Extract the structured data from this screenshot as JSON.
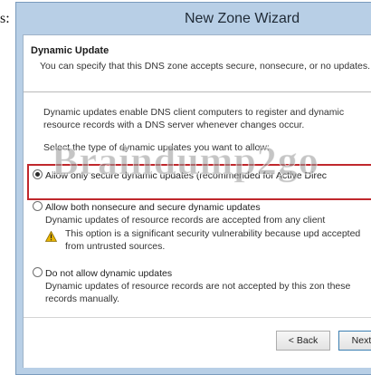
{
  "edge_text": "s:",
  "window": {
    "title": "New Zone Wizard"
  },
  "header": {
    "title": "Dynamic Update",
    "description": "You can specify that this DNS zone accepts secure, nonsecure, or no updates."
  },
  "body": {
    "intro": "Dynamic updates enable DNS client computers to register and dynamic resource records with a DNS server whenever changes occur.",
    "intro_line1": "Dynamic updates enable DNS client computers to register and dynamic",
    "intro_line2": "resource records with a DNS server whenever changes occur.",
    "prompt": "Select the type of dynamic updates you want to allow:"
  },
  "options": [
    {
      "label": "Allow only secure dynamic updates (recommended for Active Direc",
      "description": "",
      "selected": true
    },
    {
      "label": "Allow both nonsecure and secure dynamic updates",
      "description": "Dynamic updates of resource records are accepted from any client",
      "warning": "This option is a significant security vulnerability because upd accepted from untrusted sources.",
      "selected": false
    },
    {
      "label": "Do not allow dynamic updates",
      "description": "Dynamic updates of resource records are not accepted by this zon these records manually.",
      "selected": false
    }
  ],
  "watermark": "Braindump2go",
  "buttons": {
    "back": "< Back",
    "next": "Next >"
  },
  "colors": {
    "selection_border": "#c0282d",
    "title_bar": "#b8cfe6",
    "warning_icon": "#e8b400"
  },
  "icons": {
    "warning": "warning-triangle-icon"
  }
}
